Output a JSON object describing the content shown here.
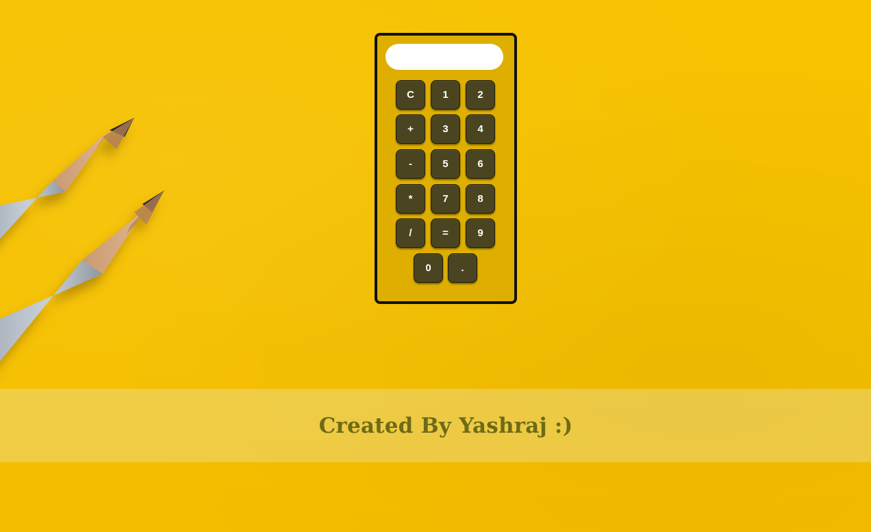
{
  "colors": {
    "background": "#f6c100",
    "calculator_body": "#deaf00",
    "calculator_border": "#111111",
    "key_background": "#4a4520",
    "key_text": "#ffffff",
    "display_background": "#ffffff",
    "banner_text": "#6e6a16"
  },
  "calculator": {
    "display_value": "",
    "keys": [
      "C",
      "1",
      "2",
      "+",
      "3",
      "4",
      "-",
      "5",
      "6",
      "*",
      "7",
      "8",
      "/",
      "=",
      "9",
      "0",
      "."
    ]
  },
  "banner": {
    "text": "Created By Yashraj :)"
  },
  "decor": {
    "pencil_icon_count": 2
  }
}
